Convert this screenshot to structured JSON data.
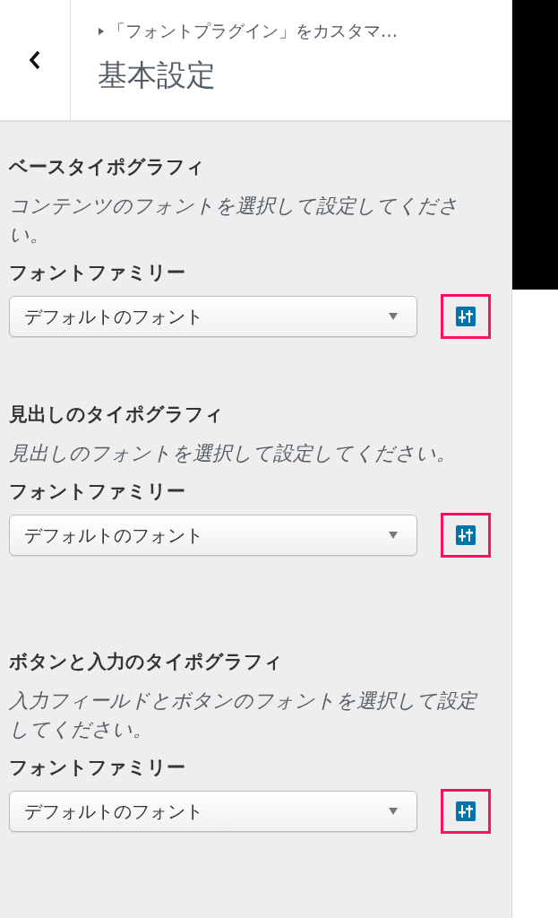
{
  "header": {
    "breadcrumb": "「フォントプラグイン」をカスタマ…",
    "title": "基本設定"
  },
  "sections": [
    {
      "title": "ベースタイポグラフィ",
      "description": "コンテンツのフォントを選択して設定してください。",
      "label": "フォントファミリー",
      "value": "デフォルトのフォント",
      "highlighted": true
    },
    {
      "title": "見出しのタイポグラフィ",
      "description": "見出しのフォントを選択して設定してください。",
      "label": "フォントファミリー",
      "value": "デフォルトのフォント",
      "highlighted": true
    },
    {
      "title": "ボタンと入力のタイポグラフィ",
      "description": "入力フィールドとボタンのフォントを選択して設定してください。",
      "label": "フォントファミリー",
      "value": "デフォルトのフォント",
      "highlighted": true
    }
  ]
}
